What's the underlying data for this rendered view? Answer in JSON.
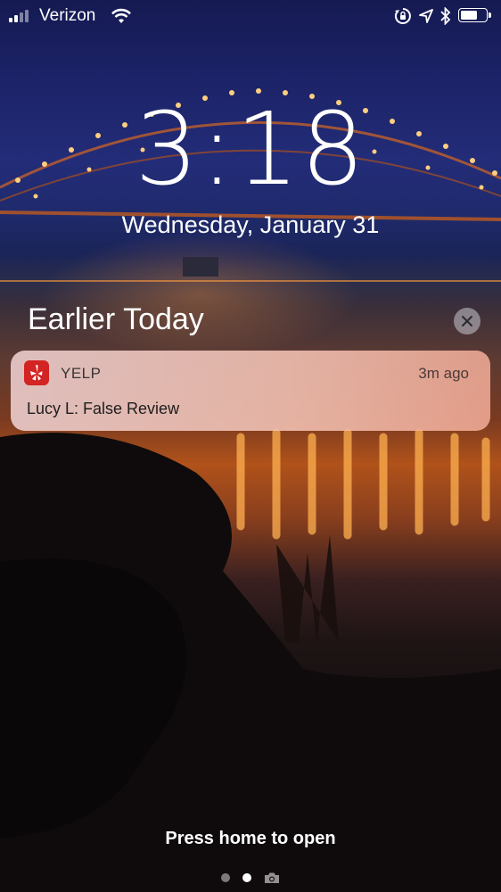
{
  "status_bar": {
    "carrier": "Verizon",
    "icons": [
      "signal-bars",
      "wifi-icon",
      "orientation-lock-icon",
      "location-arrow-icon",
      "bluetooth-icon",
      "battery-icon"
    ],
    "battery_level": 0.65
  },
  "lock_screen": {
    "time": "3:18",
    "date": "Wednesday, January 31"
  },
  "notifications": {
    "section_title": "Earlier Today",
    "clear_icon": "close-icon",
    "items": [
      {
        "app": "YELP",
        "app_color": "#d32323",
        "time": "3m ago",
        "body": "Lucy L: False Review"
      }
    ]
  },
  "footer": {
    "hint": "Press home to open",
    "pages": [
      "dot",
      "dot-active",
      "camera-icon"
    ]
  }
}
